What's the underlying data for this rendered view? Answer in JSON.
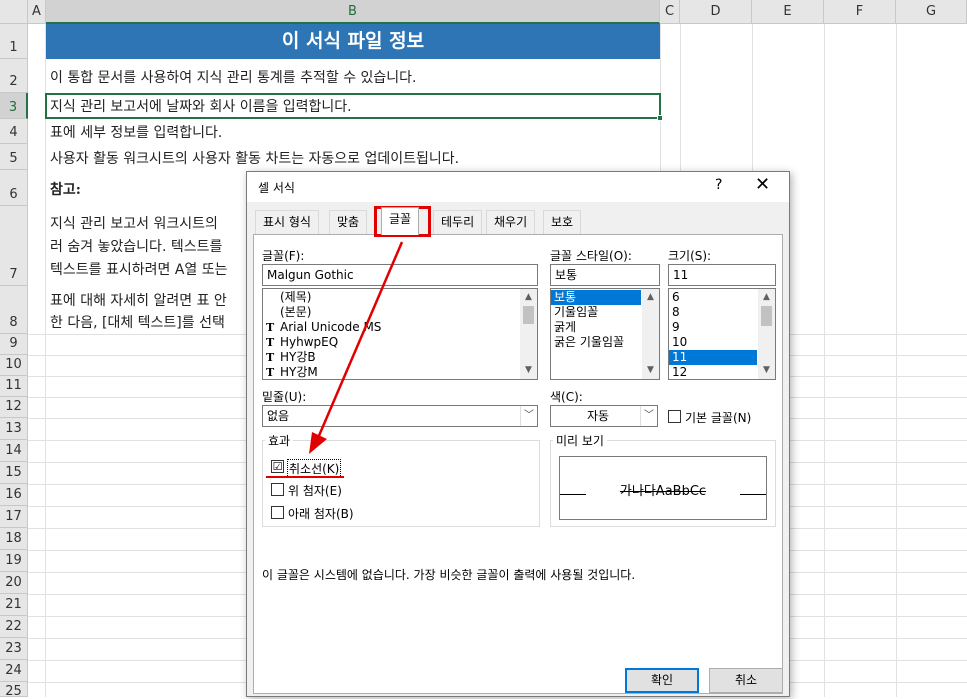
{
  "sheet": {
    "columns": [
      "A",
      "B",
      "C",
      "D",
      "E",
      "F",
      "G"
    ],
    "rows": [
      "1",
      "2",
      "3",
      "4",
      "5",
      "6",
      "7",
      "8",
      "9",
      "10",
      "11",
      "12",
      "13",
      "14",
      "15",
      "16",
      "17",
      "18",
      "19",
      "20",
      "21",
      "22",
      "23",
      "24",
      "25"
    ],
    "title": "이 서식 파일 정보",
    "b2": "이 통합 문서를 사용하여 지식 관리 통계를 추적할 수 있습니다.",
    "b3": "지식 관리 보고서에 날짜와 회사 이름을 입력합니다.",
    "b4": "표에 세부 정보를 입력합니다.",
    "b5": "사용자 활동 워크시트의 사용자 활동 차트는 자동으로 업데이트됩니다.",
    "b6": "참고:",
    "b7_line1": "지식 관리 보고서 워크시트의",
    "b7_line2": "러 숨겨 놓았습니다. 텍스트를",
    "b7_line3": "텍스트를 표시하려면 A열 또는",
    "b8_line1": "표에 대해 자세히 알려면 표 안",
    "b8_line2": "한 다음, [대체 텍스트]를 선택"
  },
  "dialog": {
    "title": "셀 서식",
    "help": "?",
    "close": "✕",
    "tabs": [
      "표시 형식",
      "맞춤",
      "글꼴",
      "테두리",
      "채우기",
      "보호"
    ],
    "active_tab": "글꼴",
    "font_label": "글꼴(F):",
    "font_value": "Malgun Gothic",
    "font_list": [
      {
        "icon": "",
        "label": "(제목)"
      },
      {
        "icon": "",
        "label": "(본문)"
      },
      {
        "icon": "T",
        "label": "Arial Unicode MS"
      },
      {
        "icon": "T",
        "label": "HyhwpEQ"
      },
      {
        "icon": "T",
        "label": "HY강B"
      },
      {
        "icon": "T",
        "label": "HY강M"
      }
    ],
    "style_label": "글꼴 스타일(O):",
    "style_value": "보통",
    "style_list": [
      "보통",
      "기울임꼴",
      "굵게",
      "굵은 기울임꼴"
    ],
    "size_label": "크기(S):",
    "size_value": "11",
    "size_list": [
      "6",
      "8",
      "9",
      "10",
      "11",
      "12"
    ],
    "underline_label": "밑줄(U):",
    "underline_value": "없음",
    "color_label": "색(C):",
    "color_value": "자동",
    "normal_font_label": "기본 글꼴(N)",
    "effects_label": "효과",
    "strike_label": "취소선(K)",
    "strike_checked": "☑",
    "super_label": "위 첨자(E)",
    "sub_label": "아래 첨자(B)",
    "preview_label": "미리 보기",
    "preview_text": "가나다AaBbCc",
    "note": "이 글꼴은 시스템에 없습니다. 가장 비슷한 글꼴이 출력에 사용될 것입니다.",
    "ok": "확인",
    "cancel": "취소"
  },
  "colors": {
    "title_fill": "#2e75b6",
    "excel_green": "#217346",
    "annotation_red": "#e00000",
    "selection_blue": "#0078d7"
  }
}
